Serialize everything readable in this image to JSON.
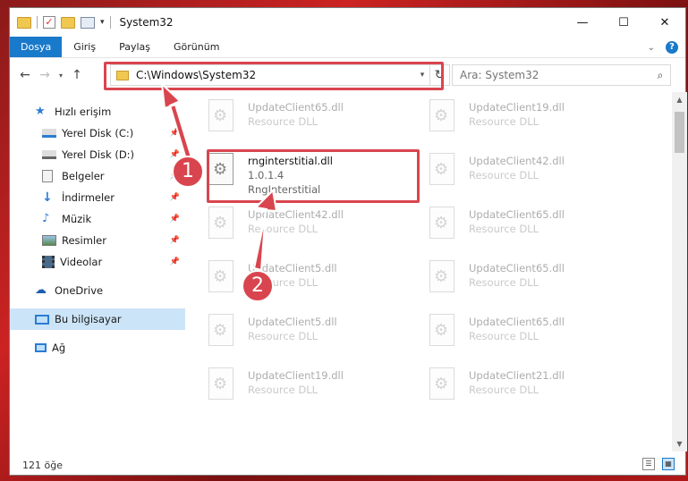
{
  "window": {
    "title": "System32",
    "controls": {
      "minimize": "—",
      "maximize": "☐",
      "close": "✕"
    }
  },
  "ribbon": {
    "tabs": [
      "Dosya",
      "Giriş",
      "Paylaş",
      "Görünüm"
    ]
  },
  "address": {
    "path": "C:\\Windows\\System32",
    "search_placeholder": "Ara: System32"
  },
  "sidebar": {
    "quick_access": "Hızlı erişim",
    "items": [
      {
        "label": "Yerel Disk (C:)",
        "icon": "drive-icon",
        "pinned": true
      },
      {
        "label": "Yerel Disk (D:)",
        "icon": "drive-icon",
        "pinned": true
      },
      {
        "label": "Belgeler",
        "icon": "documents-icon",
        "pinned": true
      },
      {
        "label": "İndirmeler",
        "icon": "download-icon",
        "pinned": true
      },
      {
        "label": "Müzik",
        "icon": "music-icon",
        "pinned": true
      },
      {
        "label": "Resimler",
        "icon": "pictures-icon",
        "pinned": true
      },
      {
        "label": "Videolar",
        "icon": "video-icon",
        "pinned": true
      }
    ],
    "onedrive": "OneDrive",
    "this_pc": "Bu bilgisayar",
    "network": "Ağ"
  },
  "files": {
    "left": [
      {
        "name": "UpdateClient65.dll",
        "meta1": "Resource DLL",
        "meta2": ""
      },
      {
        "name": "rnginterstitial.dll",
        "meta1": "1.0.1.4",
        "meta2": "RngInterstitial",
        "highlight": true
      },
      {
        "name": "UpdateClient42.dll",
        "meta1": "Resource DLL",
        "meta2": ""
      },
      {
        "name": "UpdateClient5.dll",
        "meta1": "Resource DLL",
        "meta2": ""
      },
      {
        "name": "UpdateClient5.dll",
        "meta1": "Resource DLL",
        "meta2": ""
      },
      {
        "name": "UpdateClient19.dll",
        "meta1": "Resource DLL",
        "meta2": ""
      }
    ],
    "right": [
      {
        "name": "UpdateClient19.dll",
        "meta1": "Resource DLL",
        "meta2": ""
      },
      {
        "name": "UpdateClient42.dll",
        "meta1": "Resource DLL",
        "meta2": ""
      },
      {
        "name": "UpdateClient65.dll",
        "meta1": "Resource DLL",
        "meta2": ""
      },
      {
        "name": "UpdateClient65.dll",
        "meta1": "Resource DLL",
        "meta2": ""
      },
      {
        "name": "UpdateClient65.dll",
        "meta1": "Resource DLL",
        "meta2": ""
      },
      {
        "name": "UpdateClient21.dll",
        "meta1": "Resource DLL",
        "meta2": ""
      }
    ]
  },
  "status": {
    "count": "121 öğe"
  },
  "annotations": {
    "step1": "1",
    "step2": "2",
    "color": "#d9454e"
  }
}
